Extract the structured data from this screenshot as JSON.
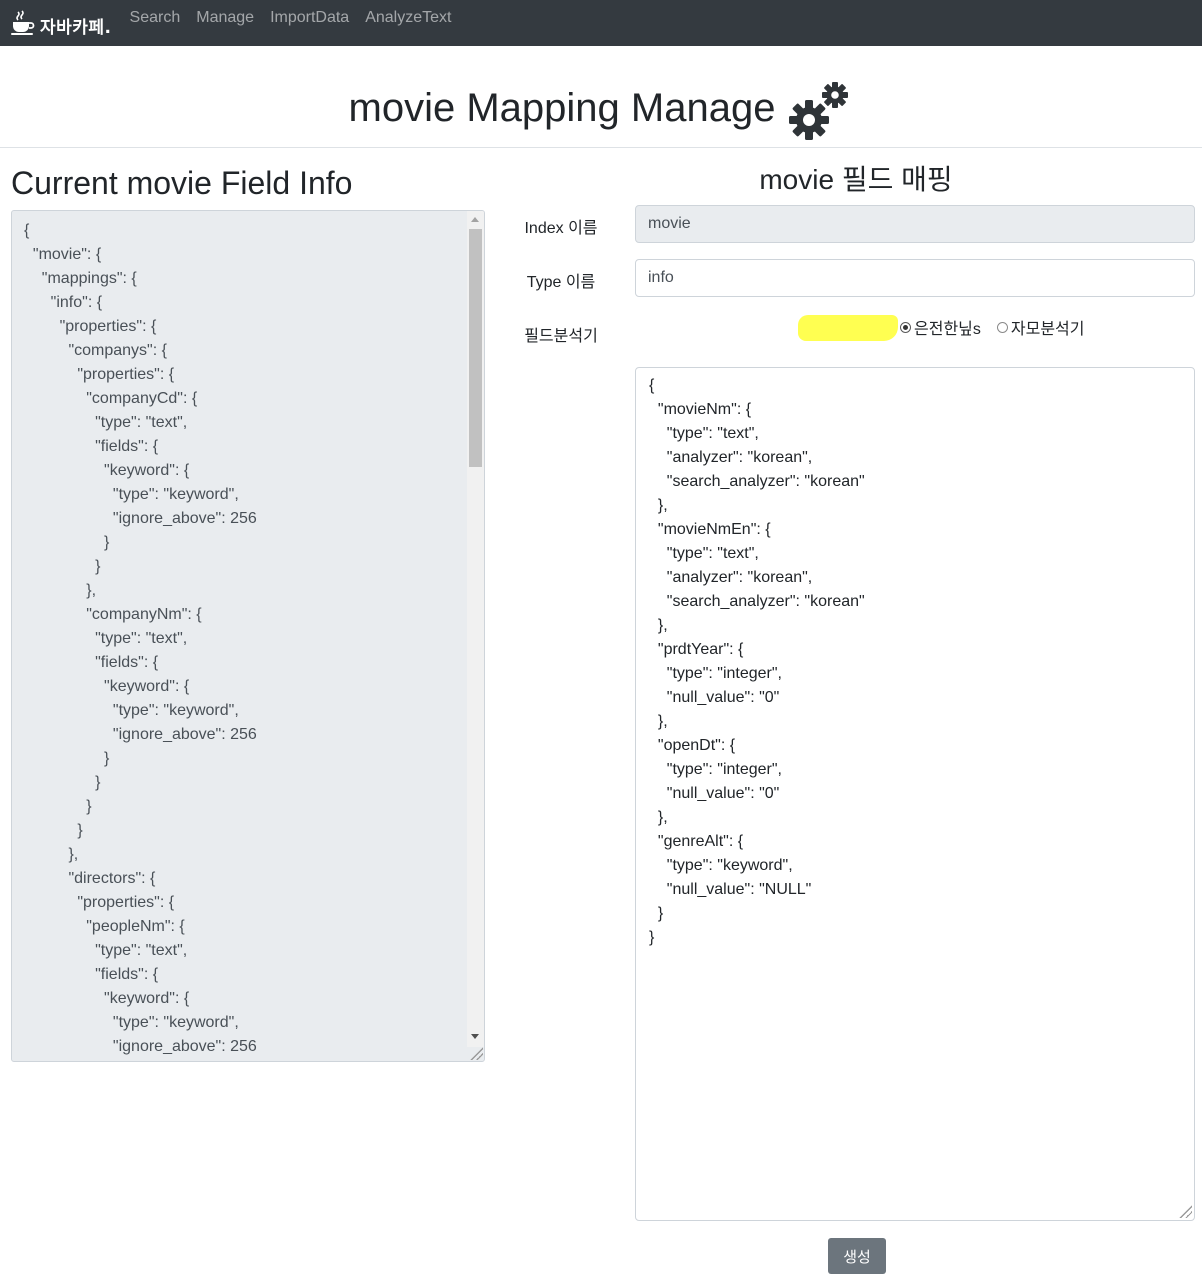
{
  "navbar": {
    "brand": "자바카페.",
    "links": [
      "Search",
      "Manage",
      "ImportData",
      "AnalyzeText"
    ]
  },
  "header": {
    "title": "movie Mapping Manage"
  },
  "left": {
    "heading": "Current movie Field Info",
    "json_text": "{\n  \"movie\": {\n    \"mappings\": {\n      \"info\": {\n        \"properties\": {\n          \"companys\": {\n            \"properties\": {\n              \"companyCd\": {\n                \"type\": \"text\",\n                \"fields\": {\n                  \"keyword\": {\n                    \"type\": \"keyword\",\n                    \"ignore_above\": 256\n                  }\n                }\n              },\n              \"companyNm\": {\n                \"type\": \"text\",\n                \"fields\": {\n                  \"keyword\": {\n                    \"type\": \"keyword\",\n                    \"ignore_above\": 256\n                  }\n                }\n              }\n            }\n          },\n          \"directors\": {\n            \"properties\": {\n              \"peopleNm\": {\n                \"type\": \"text\",\n                \"fields\": {\n                  \"keyword\": {\n                    \"type\": \"keyword\",\n                    \"ignore_above\": 256\n                  }"
  },
  "right": {
    "heading": "movie 필드 매핑",
    "index_label": "Index 이름",
    "index_value": "movie",
    "type_label": "Type 이름",
    "type_value": "info",
    "analyzer_label": "필드분석기",
    "analyzer_options": [
      "은전한닢s",
      "자모분석기"
    ],
    "analyzer_selected": "은전한닢s",
    "mapping_text": "{\n  \"movieNm\": {\n    \"type\": \"text\",\n    \"analyzer\": \"korean\",\n    \"search_analyzer\": \"korean\"\n  },\n  \"movieNmEn\": {\n    \"type\": \"text\",\n    \"analyzer\": \"korean\",\n    \"search_analyzer\": \"korean\"\n  },\n  \"prdtYear\": {\n    \"type\": \"integer\",\n    \"null_value\": \"0\"\n  },\n  \"openDt\": {\n    \"type\": \"integer\",\n    \"null_value\": \"0\"\n  },\n  \"genreAlt\": {\n    \"type\": \"keyword\",\n    \"null_value\": \"NULL\"\n  }\n}",
    "submit_label": "생성"
  },
  "colors": {
    "navbar_bg": "#343a40",
    "readonly_bg": "#e9ecef",
    "button_bg": "#6c757d",
    "highlight": "#ffff33"
  },
  "icons": {
    "brand": "coffee-cup-icon",
    "title": "gears-icon"
  }
}
